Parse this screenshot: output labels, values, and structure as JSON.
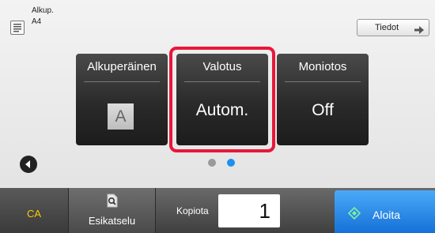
{
  "header": {
    "original_label": "Alkup.",
    "original_size": "A4",
    "details_button_label": "Tiedot",
    "details_icon": "arrow-right-icon",
    "original_icon": "document-icon"
  },
  "tiles": [
    {
      "title": "Alkuperäinen",
      "value": "A",
      "selected": false
    },
    {
      "title": "Valotus",
      "value": "Autom.",
      "selected": true
    },
    {
      "title": "Moniotos",
      "value": "Off",
      "selected": false
    }
  ],
  "pager": {
    "page_count": 2,
    "current_page": 2
  },
  "bottom_bar": {
    "ca_label": "CA",
    "preview_label": "Esikatselu",
    "preview_icon": "magnifier-document-icon",
    "copies_label": "Kopiota",
    "copies_value": "1",
    "start_label": "Aloita",
    "start_icon": "diamond-start-icon"
  },
  "colors": {
    "highlight": "#e8173a",
    "ca_text": "#ffc800",
    "start_button": "#1e7fe6",
    "active_dot": "#1e90ee"
  }
}
